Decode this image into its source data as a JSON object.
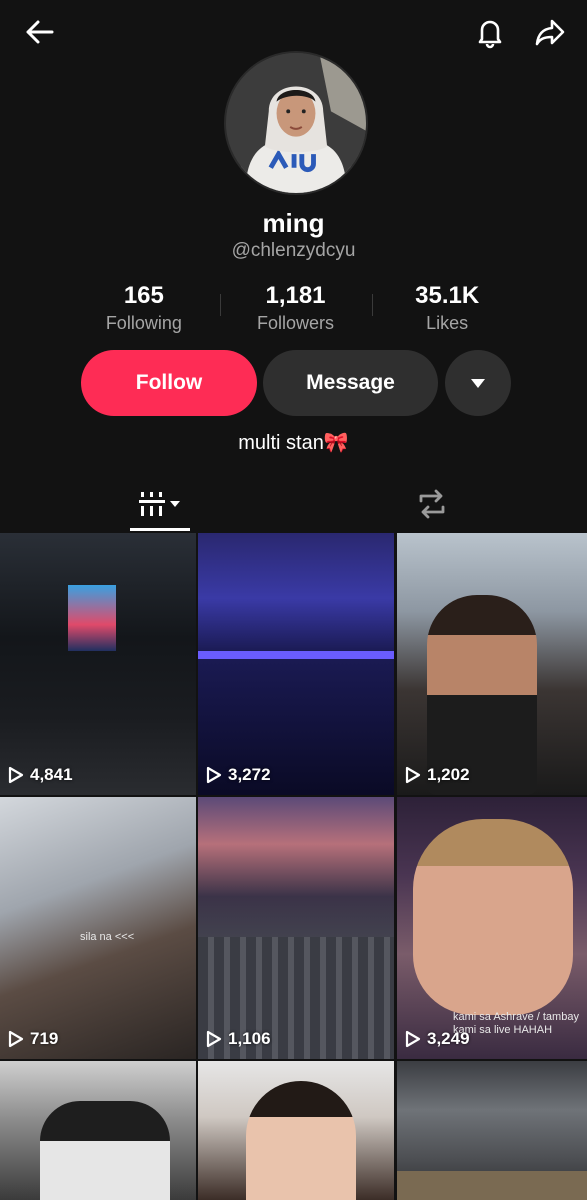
{
  "profile": {
    "name": "ming",
    "handle": "@chlenzydcyu",
    "bio": "multi stan🎀"
  },
  "stats": [
    {
      "value": "165",
      "label": "Following"
    },
    {
      "value": "1,181",
      "label": "Followers"
    },
    {
      "value": "35.1K",
      "label": "Likes"
    }
  ],
  "actions": {
    "follow_label": "Follow",
    "message_label": "Message"
  },
  "colors": {
    "follow": "#fe2c55",
    "background": "#121212",
    "secondary_button": "#2f2f2f"
  },
  "icons": {
    "back": "back-arrow-icon",
    "notifications": "bell-icon",
    "share": "share-icon",
    "more": "dropdown-triangle-icon",
    "videos_tab": "grid-icon",
    "reposts_tab": "repost-icon"
  },
  "videos": [
    {
      "views": "4,841"
    },
    {
      "views": "3,272"
    },
    {
      "views": "1,202"
    },
    {
      "views": "719",
      "caption": "sila na <<<"
    },
    {
      "views": "1,106"
    },
    {
      "views": "3,249",
      "caption": "kami sa Ashrave / tambay kami sa live HAHAH"
    },
    {
      "views": ""
    },
    {
      "views": ""
    },
    {
      "views": ""
    }
  ]
}
